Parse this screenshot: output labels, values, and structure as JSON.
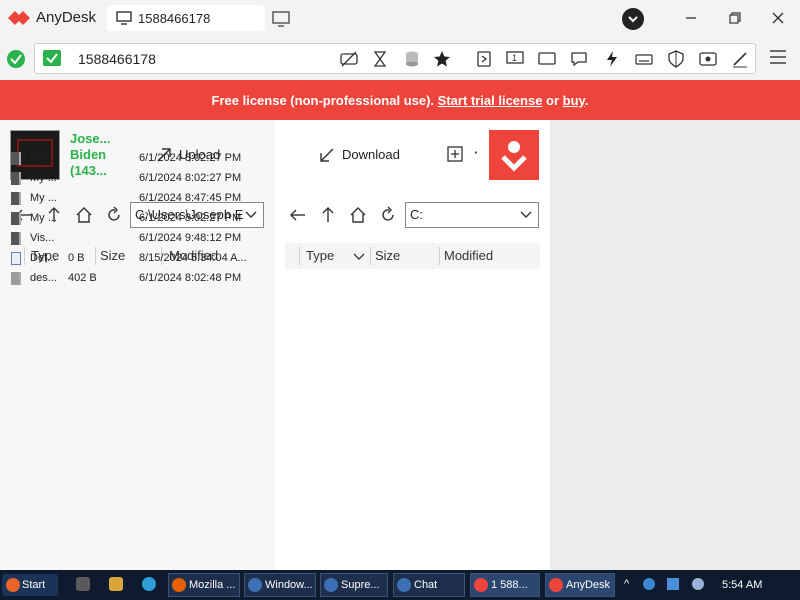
{
  "app": {
    "title": "AnyDesk",
    "tab_label": "1588466178"
  },
  "address": {
    "value": "1588466178"
  },
  "colors": {
    "brand": "#ef443b",
    "online": "#2bb24c",
    "banner_text": "#ffffff"
  },
  "banner": {
    "prefix": "Free license (non-professional use). ",
    "trial_link": "Start trial license",
    "middle": " or ",
    "buy_link": "buy",
    "suffix": "."
  },
  "session": {
    "user_name": "Jose... Biden (143..."
  },
  "actions": {
    "upload": "Upload",
    "download": "Download",
    "more": "·"
  },
  "local": {
    "path": "C:\\Users\\Joseph E",
    "columns": {
      "type": "Type",
      "size": "Size",
      "modified": "Modified"
    },
    "files": [
      {
        "name": "My ...",
        "size": "",
        "modified": "6/1/2024 8:02:27 PM",
        "icon": "folder-icon"
      },
      {
        "name": "My ...",
        "size": "",
        "modified": "6/1/2024 8:02:27 PM",
        "icon": "folder-icon"
      },
      {
        "name": "My ...",
        "size": "",
        "modified": "6/1/2024 8:47:45 PM",
        "icon": "folder-icon"
      },
      {
        "name": "My ...",
        "size": "",
        "modified": "6/1/2024 8:02:27 PM",
        "icon": "folder-icon"
      },
      {
        "name": "Vis...",
        "size": "",
        "modified": "6/1/2024 9:48:12 PM",
        "icon": "folder-icon"
      },
      {
        "name": "Def...",
        "size": "0 B",
        "modified": "8/15/2024 5:34:04 A...",
        "icon": "shortcut-icon"
      },
      {
        "name": "des...",
        "size": "402 B",
        "modified": "6/1/2024 8:02:48 PM",
        "icon": "file-icon"
      }
    ]
  },
  "remote": {
    "path": "C:",
    "columns": {
      "type": "Type",
      "size": "Size",
      "modified": "Modified"
    }
  },
  "taskbar": {
    "start": "Start",
    "apps": [
      {
        "label": "Mozilla ...",
        "color": "#e66000"
      },
      {
        "label": "Window...",
        "color": "#3d6fb6"
      },
      {
        "label": "Supre...",
        "color": "#3d6fb6"
      },
      {
        "label": "Chat",
        "color": "#3d6fb6"
      },
      {
        "label": "1 588...",
        "color": "#ef443b"
      },
      {
        "label": "AnyDesk",
        "color": "#ef443b"
      }
    ],
    "clock": "5:54 AM"
  }
}
